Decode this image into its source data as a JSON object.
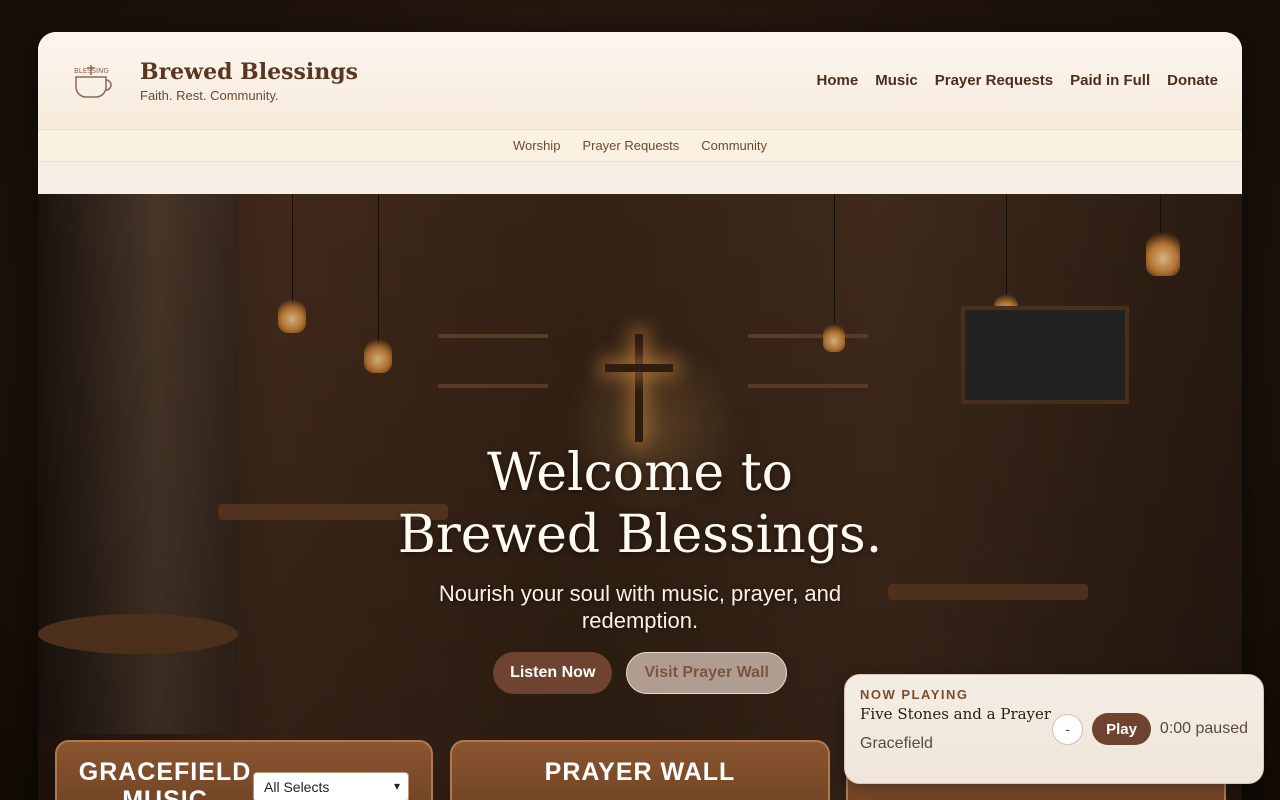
{
  "brand": {
    "title": "Brewed Blessings",
    "tagline": "Faith. Rest. Community.",
    "logo_text": "BLESSING BREWED"
  },
  "nav": {
    "items": [
      {
        "label": "Home"
      },
      {
        "label": "Music"
      },
      {
        "label": "Prayer Requests"
      },
      {
        "label": "Paid in Full"
      },
      {
        "label": "Donate"
      }
    ]
  },
  "subnav": {
    "items": [
      {
        "label": "Worship"
      },
      {
        "label": "Prayer Requests"
      },
      {
        "label": "Community"
      }
    ]
  },
  "hero": {
    "title": "Welcome to Brewed Blessings.",
    "subtitle": "Nourish your soul with music, prayer, and redemption.",
    "primary_button": "Listen Now",
    "secondary_button": "Visit Prayer Wall"
  },
  "cards": {
    "music": {
      "title": "GRACEFIELD MUSIC",
      "select_value": "All Selects"
    },
    "prayer": {
      "title": "PRAYER WALL"
    }
  },
  "player": {
    "label": "NOW PLAYING",
    "track": "Five Stones and a Prayer",
    "artist": "Gracefield",
    "minus_label": "-",
    "play_label": "Play",
    "status": "0:00 paused"
  },
  "colors": {
    "accent": "#6e4330",
    "brand_text": "#5a3621"
  }
}
